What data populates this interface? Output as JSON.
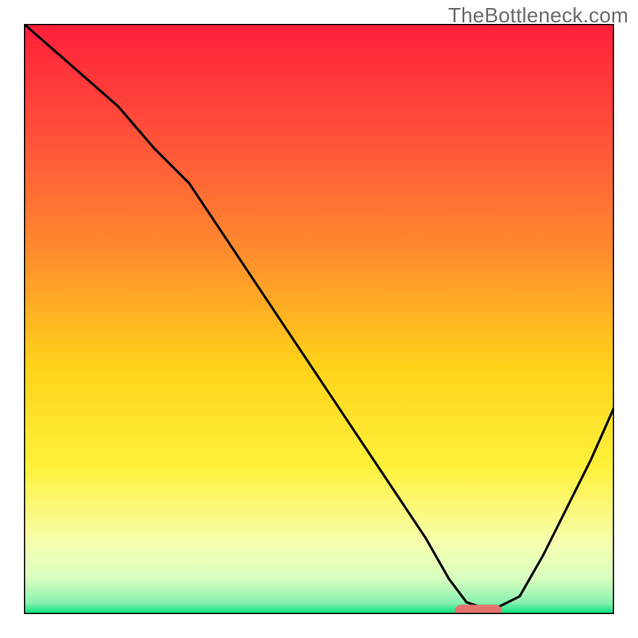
{
  "branding": {
    "watermark": "TheBottleneck.com"
  },
  "chart_data": {
    "type": "line",
    "title": "",
    "xlabel": "",
    "ylabel": "",
    "xlim": [
      0,
      100
    ],
    "ylim": [
      0,
      100
    ],
    "grid": false,
    "legend": false,
    "background": {
      "type": "vertical-gradient",
      "stops": [
        {
          "pos": 0.0,
          "color": "#ff1f3a"
        },
        {
          "pos": 0.18,
          "color": "#ff4e3a"
        },
        {
          "pos": 0.38,
          "color": "#ff8a2e"
        },
        {
          "pos": 0.58,
          "color": "#ffd21a"
        },
        {
          "pos": 0.75,
          "color": "#fff13a"
        },
        {
          "pos": 0.88,
          "color": "#f6ffb0"
        },
        {
          "pos": 0.94,
          "color": "#d8ffbf"
        },
        {
          "pos": 0.98,
          "color": "#8cf2b0"
        },
        {
          "pos": 1.0,
          "color": "#00e47a"
        }
      ]
    },
    "series": [
      {
        "name": "bottleneck-curve",
        "color": "#000000",
        "x": [
          0,
          8,
          16,
          22,
          28,
          36,
          44,
          52,
          60,
          68,
          72,
          75,
          78,
          80,
          84,
          88,
          92,
          96,
          100
        ],
        "y": [
          100,
          93,
          86,
          79,
          73,
          61,
          49,
          37,
          25,
          13,
          6,
          2,
          1,
          1,
          3,
          10,
          18,
          26,
          35
        ]
      }
    ],
    "markers": [
      {
        "name": "optimal-zone",
        "shape": "rounded-bar",
        "color": "#e6746d",
        "x_center": 77,
        "width": 8,
        "y": 0.5,
        "height": 2.2
      }
    ],
    "axes": {
      "show_ticks": false,
      "frame": true,
      "frame_color": "#000000"
    }
  }
}
